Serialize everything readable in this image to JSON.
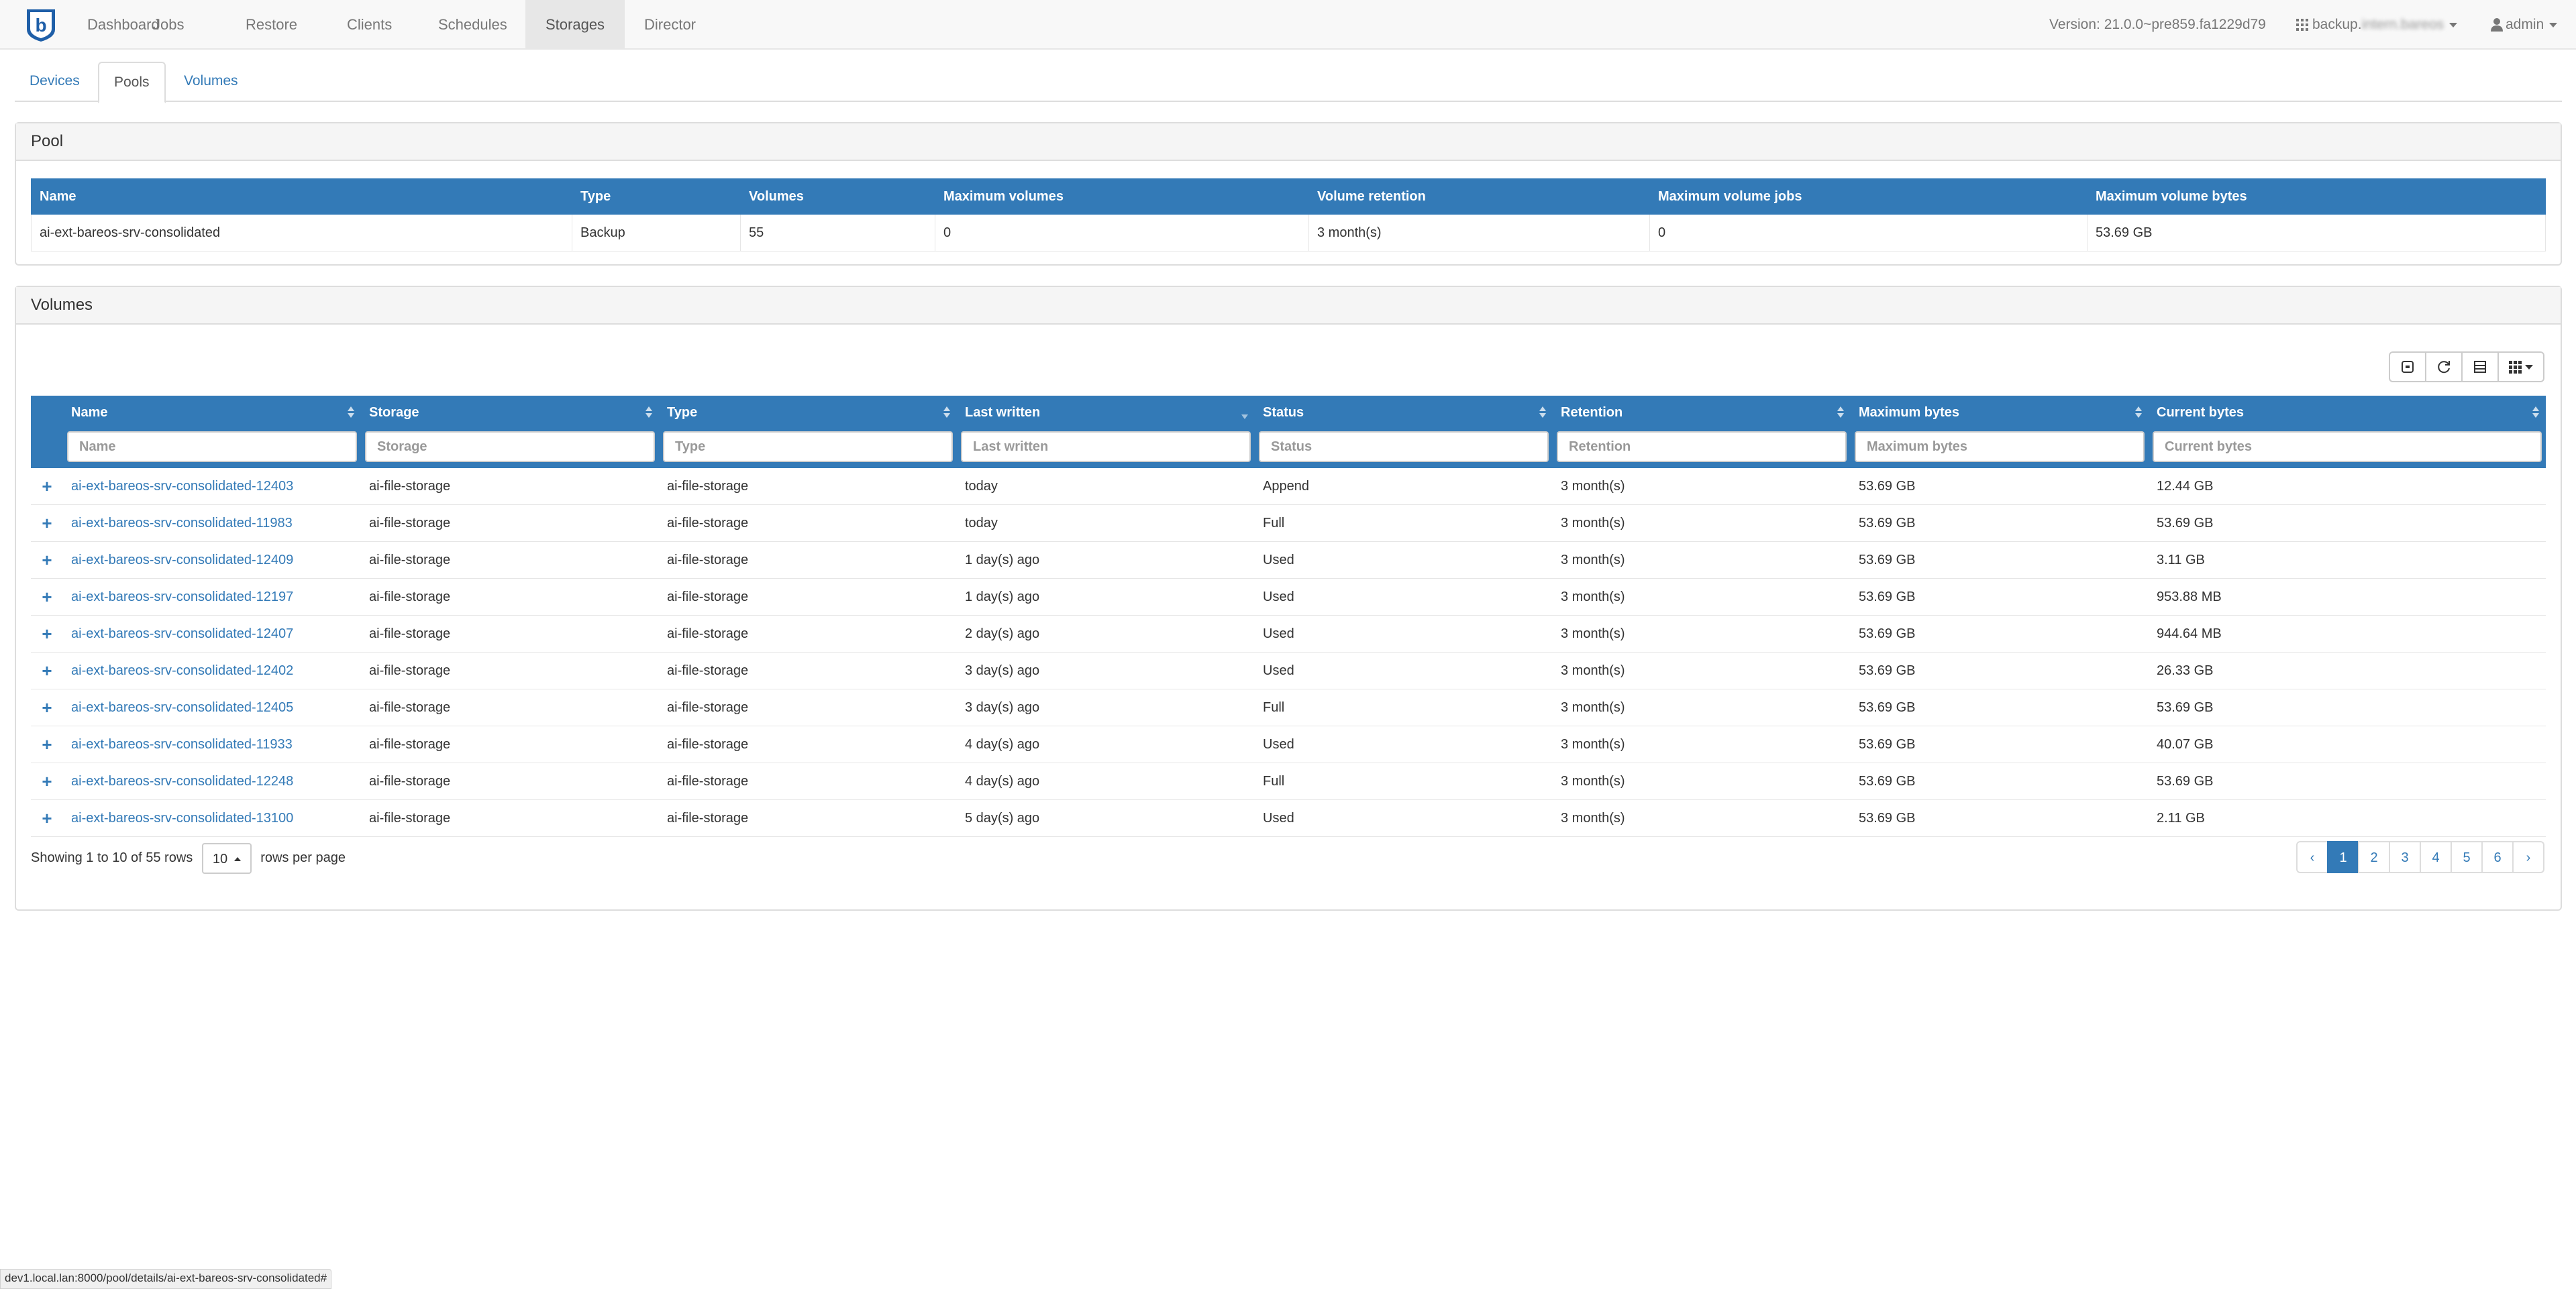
{
  "nav": {
    "items": [
      "Dashboard",
      "Jobs",
      "Restore",
      "Clients",
      "Schedules",
      "Storages",
      "Director"
    ],
    "active": "Storages",
    "version": "Version: 21.0.0~pre859.fa1229d79",
    "director_prefix": "backup.",
    "director_blurred": "intern.bareos",
    "user": "admin"
  },
  "tabs": [
    "Devices",
    "Pools",
    "Volumes"
  ],
  "active_tab": "Pools",
  "pool": {
    "heading": "Pool",
    "columns": [
      "Name",
      "Type",
      "Volumes",
      "Maximum volumes",
      "Volume retention",
      "Maximum volume jobs",
      "Maximum volume bytes"
    ],
    "row": [
      "ai-ext-bareos-srv-consolidated",
      "Backup",
      "55",
      "0",
      "3 month(s)",
      "0",
      "53.69 GB"
    ]
  },
  "volumes": {
    "heading": "Volumes",
    "columns": [
      "Name",
      "Storage",
      "Type",
      "Last written",
      "Status",
      "Retention",
      "Maximum bytes",
      "Current bytes"
    ],
    "filters": [
      "Name",
      "Storage",
      "Type",
      "Last written",
      "Status",
      "Retention",
      "Maximum bytes",
      "Current bytes"
    ],
    "rows": [
      [
        "ai-ext-bareos-srv-consolidated-12403",
        "ai-file-storage",
        "ai-file-storage",
        "today",
        "Append",
        "3 month(s)",
        "53.69 GB",
        "12.44 GB"
      ],
      [
        "ai-ext-bareos-srv-consolidated-11983",
        "ai-file-storage",
        "ai-file-storage",
        "today",
        "Full",
        "3 month(s)",
        "53.69 GB",
        "53.69 GB"
      ],
      [
        "ai-ext-bareos-srv-consolidated-12409",
        "ai-file-storage",
        "ai-file-storage",
        "1 day(s) ago",
        "Used",
        "3 month(s)",
        "53.69 GB",
        "3.11 GB"
      ],
      [
        "ai-ext-bareos-srv-consolidated-12197",
        "ai-file-storage",
        "ai-file-storage",
        "1 day(s) ago",
        "Used",
        "3 month(s)",
        "53.69 GB",
        "953.88 MB"
      ],
      [
        "ai-ext-bareos-srv-consolidated-12407",
        "ai-file-storage",
        "ai-file-storage",
        "2 day(s) ago",
        "Used",
        "3 month(s)",
        "53.69 GB",
        "944.64 MB"
      ],
      [
        "ai-ext-bareos-srv-consolidated-12402",
        "ai-file-storage",
        "ai-file-storage",
        "3 day(s) ago",
        "Used",
        "3 month(s)",
        "53.69 GB",
        "26.33 GB"
      ],
      [
        "ai-ext-bareos-srv-consolidated-12405",
        "ai-file-storage",
        "ai-file-storage",
        "3 day(s) ago",
        "Full",
        "3 month(s)",
        "53.69 GB",
        "53.69 GB"
      ],
      [
        "ai-ext-bareos-srv-consolidated-11933",
        "ai-file-storage",
        "ai-file-storage",
        "4 day(s) ago",
        "Used",
        "3 month(s)",
        "53.69 GB",
        "40.07 GB"
      ],
      [
        "ai-ext-bareos-srv-consolidated-12248",
        "ai-file-storage",
        "ai-file-storage",
        "4 day(s) ago",
        "Full",
        "3 month(s)",
        "53.69 GB",
        "53.69 GB"
      ],
      [
        "ai-ext-bareos-srv-consolidated-13100",
        "ai-file-storage",
        "ai-file-storage",
        "5 day(s) ago",
        "Used",
        "3 month(s)",
        "53.69 GB",
        "2.11 GB"
      ]
    ],
    "showing": "Showing 1 to 10 of 55 rows",
    "page_size": "10",
    "rows_per_page": "rows per page",
    "pages": [
      "‹",
      "1",
      "2",
      "3",
      "4",
      "5",
      "6",
      "›"
    ],
    "active_page": "1"
  },
  "status_url": "dev1.local.lan:8000/pool/details/ai-ext-bareos-srv-consolidated#",
  "colors": {
    "primary": "#337ab7",
    "navbar_bg": "#f8f8f8",
    "panel_heading_bg": "#f5f5f5"
  },
  "icons": {
    "brand": "bareos-logo-icon",
    "toolbar": [
      "toggle-pagination-icon",
      "refresh-icon",
      "toggle-view-icon",
      "columns-grid-icon"
    ],
    "row_expand": "plus-icon",
    "user": "user-icon",
    "director": "grid-icon"
  }
}
